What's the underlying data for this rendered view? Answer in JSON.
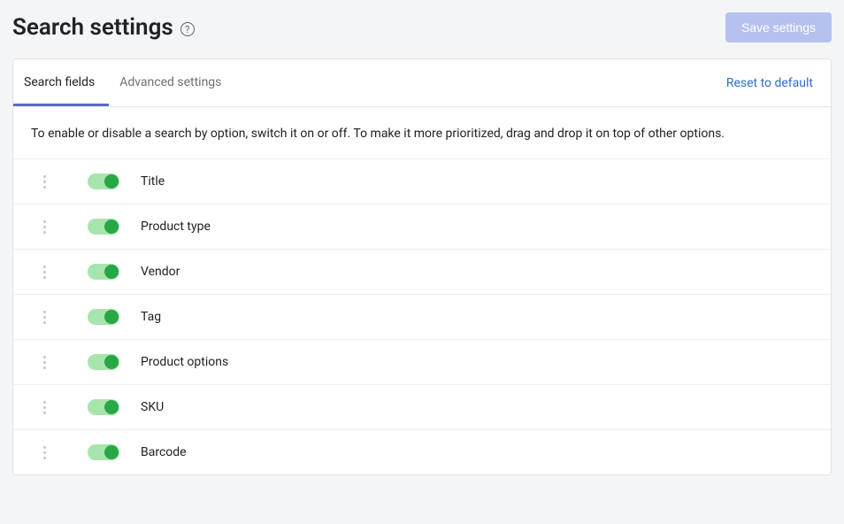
{
  "header": {
    "title": "Search settings",
    "save_label": "Save settings"
  },
  "tabs": {
    "search_fields": "Search fields",
    "advanced_settings": "Advanced settings",
    "active": "search_fields"
  },
  "actions": {
    "reset": "Reset to default"
  },
  "description": "To enable or disable a search by option, switch it on or off. To make it more prioritized, drag and drop it on top of other options.",
  "fields": [
    {
      "label": "Title",
      "enabled": true
    },
    {
      "label": "Product type",
      "enabled": true
    },
    {
      "label": "Vendor",
      "enabled": true
    },
    {
      "label": "Tag",
      "enabled": true
    },
    {
      "label": "Product options",
      "enabled": true
    },
    {
      "label": "SKU",
      "enabled": true
    },
    {
      "label": "Barcode",
      "enabled": true
    }
  ]
}
